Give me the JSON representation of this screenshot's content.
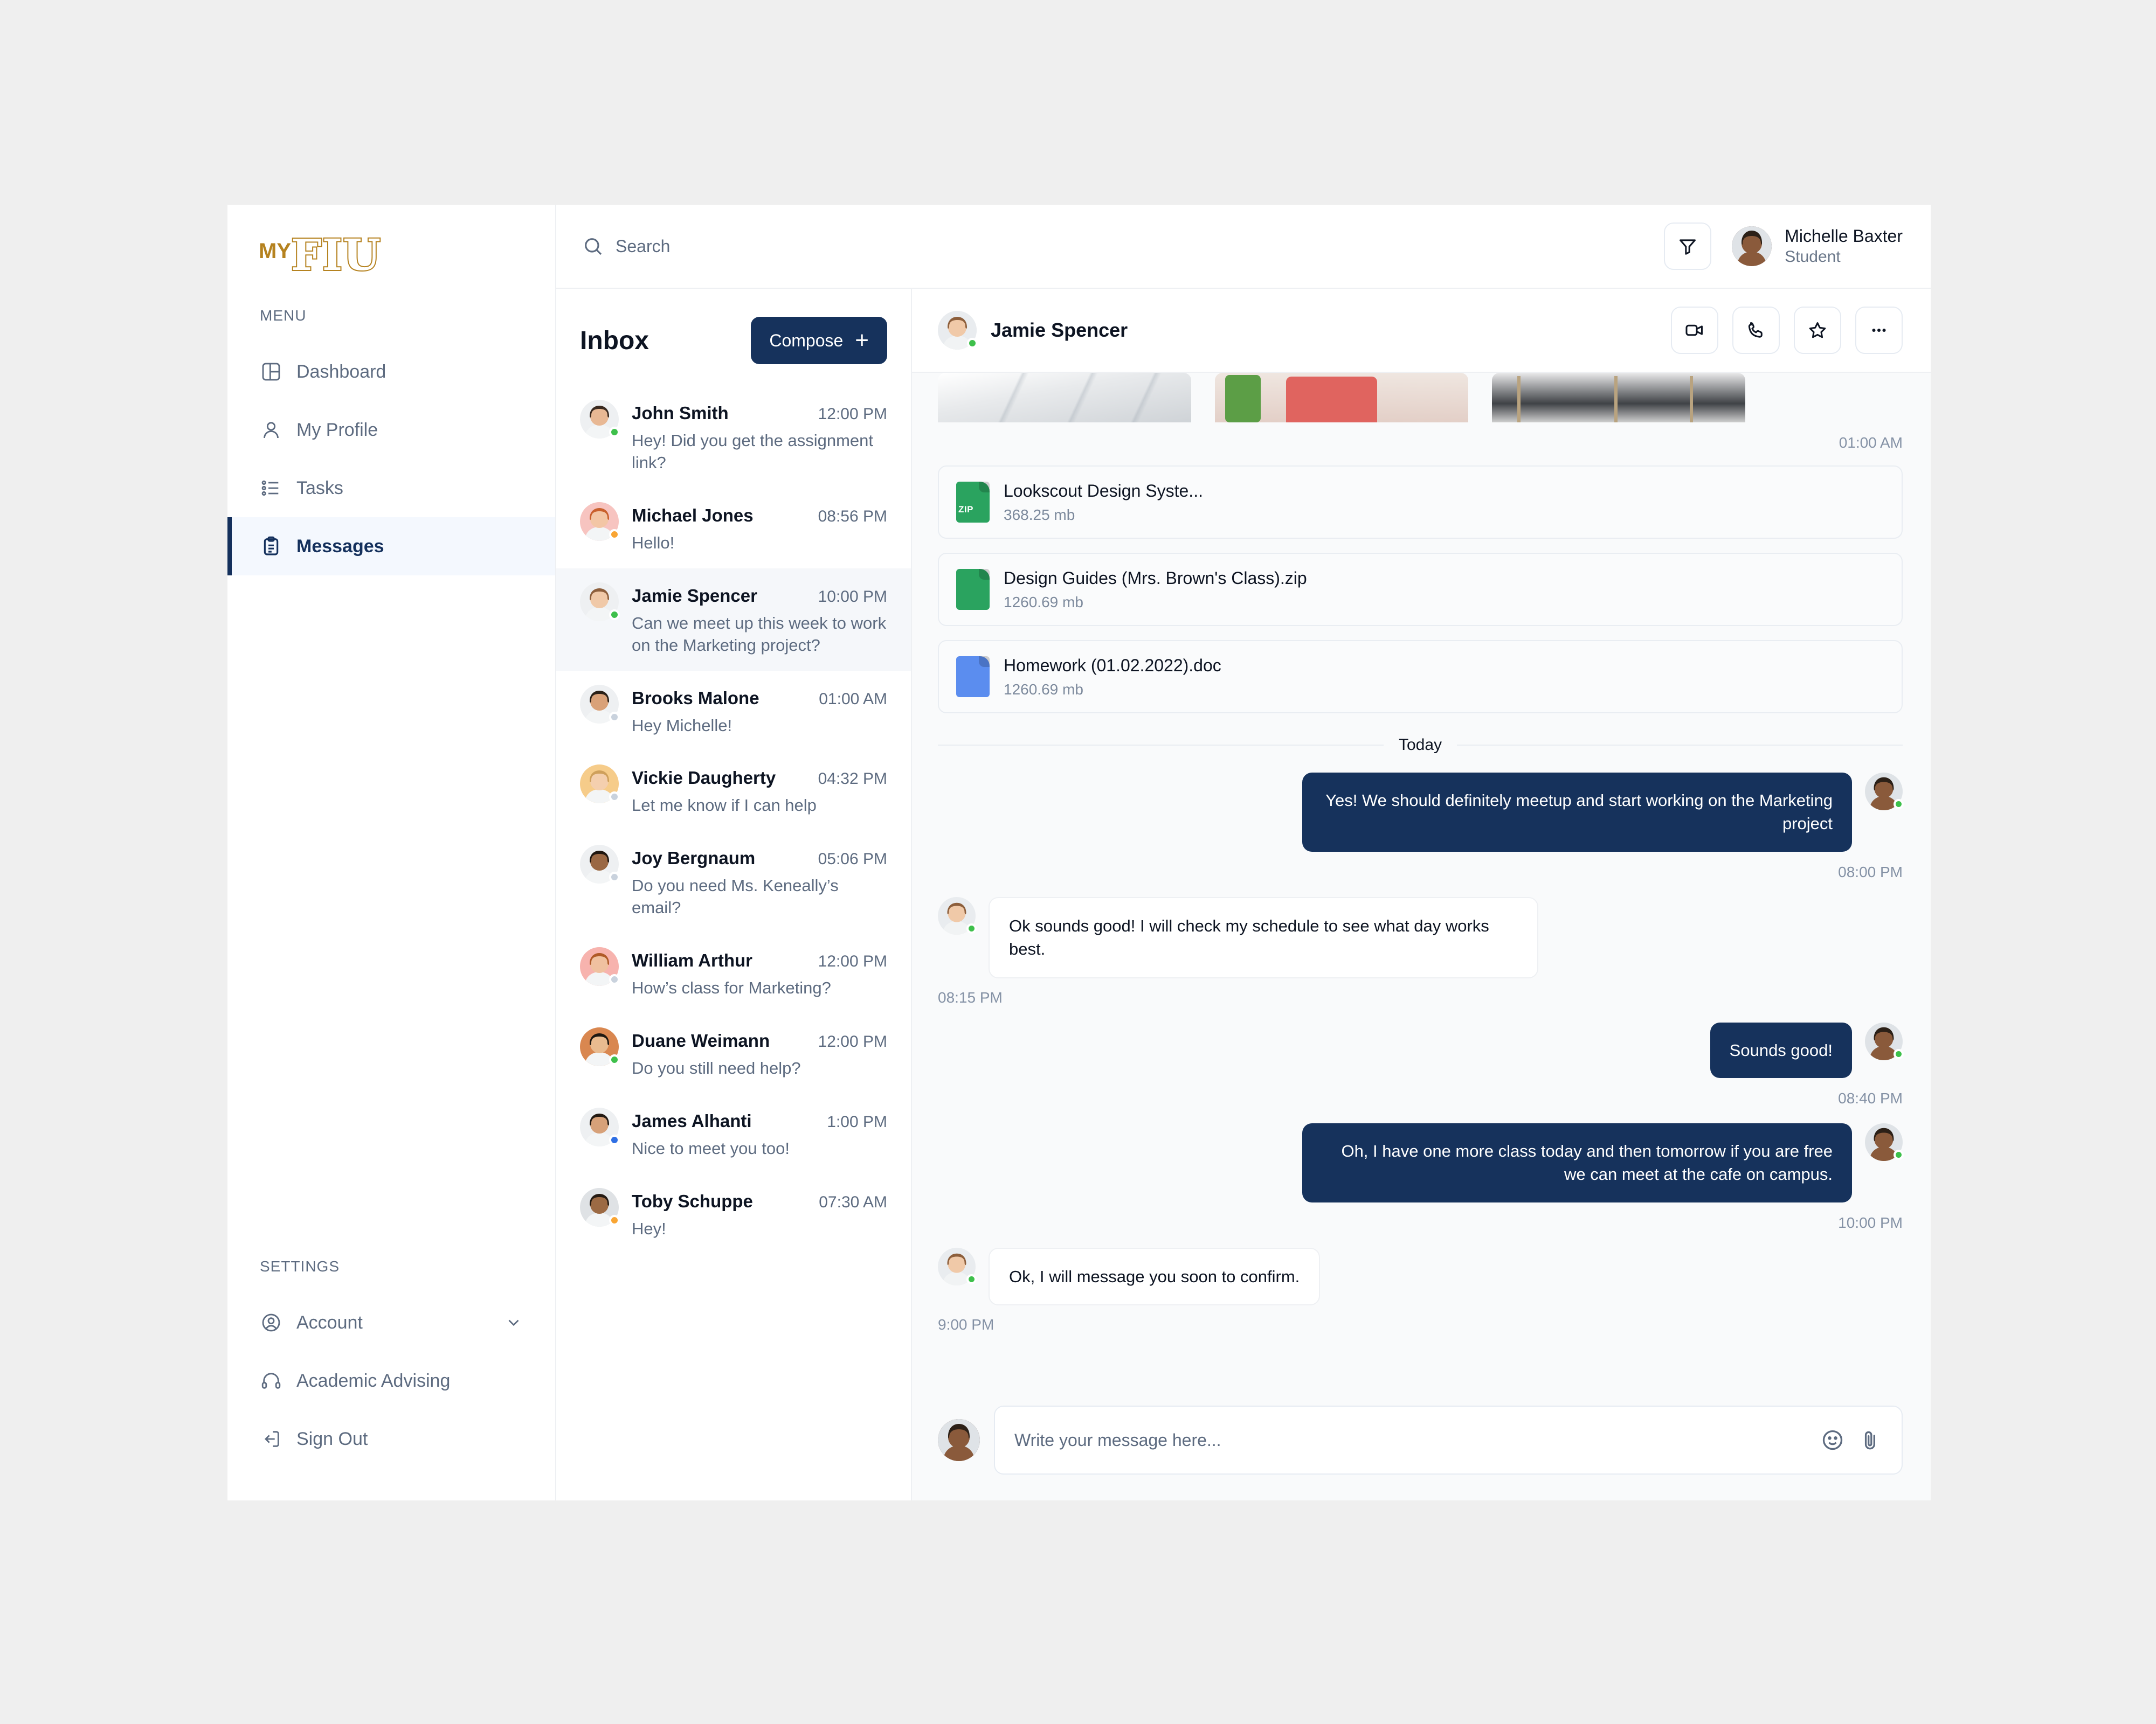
{
  "brand": {
    "logo_prefix": "MY",
    "logo_main": "FIU",
    "accent_gold": "#b5821f",
    "accent_navy": "#16325c"
  },
  "sidebar": {
    "menu_label": "MENU",
    "settings_label": "SETTINGS",
    "menu_items": [
      {
        "label": "Dashboard",
        "icon": "layout-dashboard-icon",
        "active": false
      },
      {
        "label": "My Profile",
        "icon": "user-icon",
        "active": false
      },
      {
        "label": "Tasks",
        "icon": "list-checks-icon",
        "active": false
      },
      {
        "label": "Messages",
        "icon": "clipboard-text-icon",
        "active": true
      }
    ],
    "settings_items": [
      {
        "label": "Account",
        "icon": "user-circle-icon",
        "chevron": "chevron-down-icon"
      },
      {
        "label": "Academic Advising",
        "icon": "headset-icon",
        "chevron": ""
      },
      {
        "label": "Sign Out",
        "icon": "logout-icon",
        "chevron": ""
      }
    ]
  },
  "topbar": {
    "search_placeholder": "Search",
    "search_icon": "search-icon",
    "filter_icon": "filter-icon",
    "user": {
      "name": "Michelle Baxter",
      "role": "Student"
    }
  },
  "inbox": {
    "title": "Inbox",
    "compose_label": "Compose",
    "conversations": [
      {
        "name": "John Smith",
        "time": "12:00 PM",
        "snippet": "Hey! Did you get the assignment link?",
        "status": "online",
        "selected": false
      },
      {
        "name": "Michael Jones",
        "time": "08:56 PM",
        "snippet": "Hello!",
        "status": "away",
        "selected": false
      },
      {
        "name": "Jamie Spencer",
        "time": "10:00 PM",
        "snippet": "Can we meet up this week to work on the Marketing project?",
        "status": "online",
        "selected": true
      },
      {
        "name": "Brooks Malone",
        "time": "01:00 AM",
        "snippet": "Hey Michelle!",
        "status": "offline",
        "selected": false
      },
      {
        "name": "Vickie Daugherty",
        "time": "04:32 PM",
        "snippet": "Let me know if I can help",
        "status": "offline",
        "selected": false
      },
      {
        "name": "Joy Bergnaum",
        "time": "05:06 PM",
        "snippet": "Do you need Ms. Keneally’s email?",
        "status": "offline",
        "selected": false
      },
      {
        "name": "William Arthur",
        "time": "12:00 PM",
        "snippet": "How’s class for Marketing?",
        "status": "offline",
        "selected": false
      },
      {
        "name": "Duane Weimann",
        "time": "12:00 PM",
        "snippet": "Do you still need help?",
        "status": "online",
        "selected": false
      },
      {
        "name": "James Alhanti",
        "time": "1:00 PM",
        "snippet": "Nice to meet you too!",
        "status": "busy",
        "selected": false
      },
      {
        "name": "Toby Schuppe",
        "time": "07:30 AM",
        "snippet": "Hey!",
        "status": "away",
        "selected": false
      }
    ]
  },
  "chat": {
    "peer_name": "Jamie Spencer",
    "peer_status": "online",
    "actions": [
      {
        "icon": "video-camera-icon",
        "name": "video-call-button"
      },
      {
        "icon": "phone-icon",
        "name": "voice-call-button"
      },
      {
        "icon": "star-icon",
        "name": "favorite-button"
      },
      {
        "icon": "ellipsis-icon",
        "name": "more-options-button"
      }
    ],
    "photo_time": "01:00 AM",
    "files": [
      {
        "name": "Lookscout Design Syste...",
        "size": "368.25 mb",
        "type": "zip",
        "badge": "ZIP",
        "color": "#2aa35f"
      },
      {
        "name": "Design Guides (Mrs. Brown's Class).zip",
        "size": "1260.69 mb",
        "type": "zip",
        "badge": "",
        "color": "#2aa35f"
      },
      {
        "name": "Homework (01.02.2022).doc",
        "size": "1260.69 mb",
        "type": "doc",
        "badge": "",
        "color": "#5b8def"
      }
    ],
    "day_separator": "Today",
    "messages": [
      {
        "dir": "out",
        "text": "Yes! We should definitely meetup and start working on the Marketing project",
        "time": "08:00 PM"
      },
      {
        "dir": "in",
        "text": "Ok sounds good! I will check my schedule to see what day works best.",
        "time": "08:15 PM"
      },
      {
        "dir": "out",
        "text": "Sounds good!",
        "time": "08:40 PM"
      },
      {
        "dir": "out",
        "text": "Oh, I have one more class today and then tomorrow if you are free we can meet at the cafe on campus.",
        "time": "10:00 PM"
      },
      {
        "dir": "in",
        "text": "Ok, I will message you soon to confirm.",
        "time": "9:00 PM"
      }
    ],
    "composer": {
      "placeholder": "Write your message here...",
      "emoji_icon": "smiley-icon",
      "attach_icon": "paperclip-icon"
    }
  },
  "status_colors": {
    "online": "#3ec04b",
    "away": "#f9a533",
    "busy": "#2f6fe4",
    "offline": "#c9d2dd"
  }
}
